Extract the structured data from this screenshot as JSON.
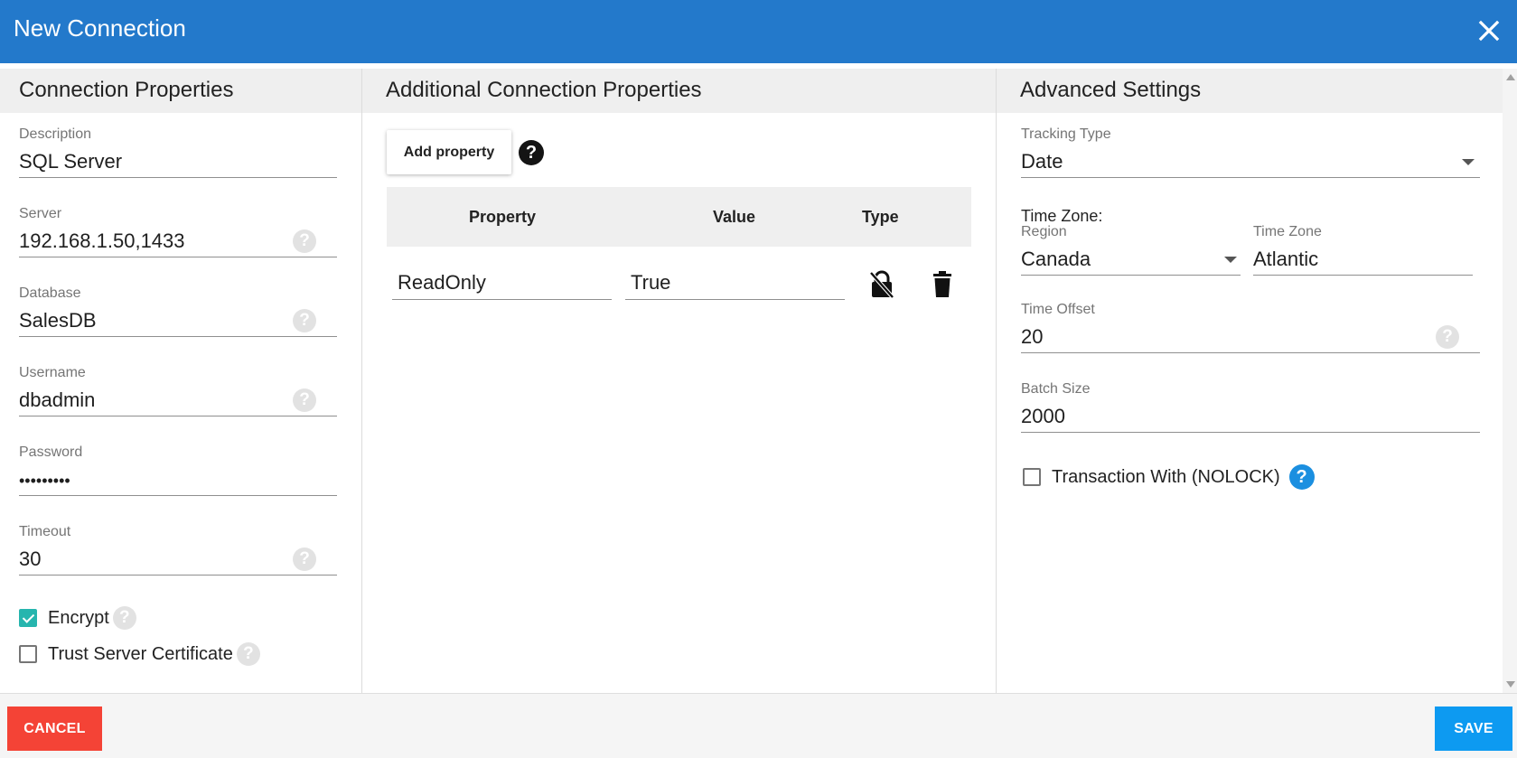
{
  "dialog": {
    "title": "New Connection"
  },
  "connection": {
    "heading": "Connection Properties",
    "description": {
      "label": "Description",
      "value": "SQL Server"
    },
    "server": {
      "label": "Server",
      "value": "192.168.1.50,1433"
    },
    "database": {
      "label": "Database",
      "value": "SalesDB"
    },
    "username": {
      "label": "Username",
      "value": "dbadmin"
    },
    "password": {
      "label": "Password",
      "value": "•••••••••"
    },
    "timeout": {
      "label": "Timeout",
      "value": "30"
    },
    "encrypt": {
      "label": "Encrypt",
      "checked": true
    },
    "trust_cert": {
      "label": "Trust Server Certificate",
      "checked": false
    }
  },
  "additional": {
    "heading": "Additional Connection Properties",
    "add_label": "Add property",
    "columns": [
      "Property",
      "Value",
      "Type"
    ],
    "rows": [
      {
        "property": "ReadOnly",
        "value": "True",
        "type_icon": "lock-off-icon"
      }
    ]
  },
  "advanced": {
    "heading": "Advanced Settings",
    "tracking_type": {
      "label": "Tracking Type",
      "value": "Date"
    },
    "time_zone_heading": "Time Zone:",
    "region": {
      "label": "Region",
      "value": "Canada"
    },
    "time_zone": {
      "label": "Time Zone",
      "value": "Atlantic"
    },
    "time_offset": {
      "label": "Time Offset",
      "value": "20"
    },
    "batch_size": {
      "label": "Batch Size",
      "value": "2000"
    },
    "nolock": {
      "label": "Transaction With (NOLOCK)",
      "checked": false
    }
  },
  "footer": {
    "cancel": "CANCEL",
    "save": "SAVE"
  },
  "help_glyph": "?",
  "colors": {
    "header": "#2379cb",
    "cancel": "#f44336",
    "save": "#0d9af1",
    "checkbox": "#26b5ae"
  }
}
